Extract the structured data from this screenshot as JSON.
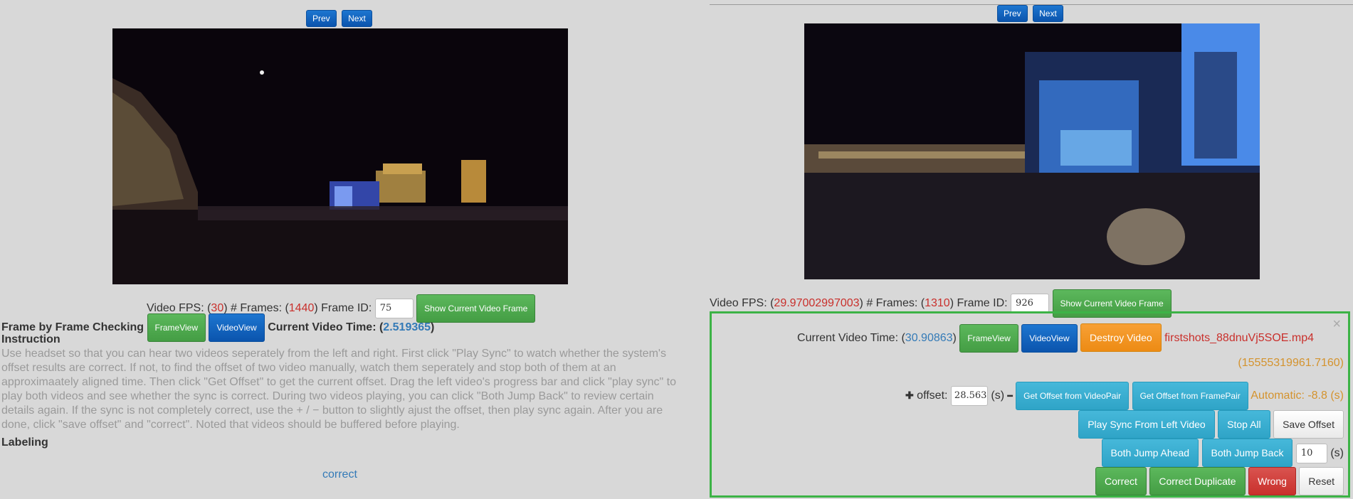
{
  "left": {
    "prev_label": "Prev",
    "next_label": "Next",
    "fps_prefix": "Video FPS: (",
    "fps": "30",
    "frames_prefix": ") # Frames: (",
    "frames": "1440",
    "frame_id_prefix": ") Frame ID:",
    "frame_id": "75",
    "show_frame_label": "Show Current Video Frame",
    "frame_check_title": "Frame by Frame Checking",
    "frameview_label": "FrameView",
    "videoview_label": "VideoView",
    "current_time_prefix": "Current Video Time: (",
    "current_time": "2.519365",
    "current_time_suffix": ")",
    "instruction_title": "Instruction",
    "instruction_text": "Use headset so that you can hear two videos seperately from the left and right. First click \"Play Sync\" to watch whether the system's offset results are correct. If not, to find the offset of two video manually, watch them seperately and stop both of them at an approximaately aligned time. Then click \"Get Offset\" to get the current offset. Drag the left video's progress bar and click \"play sync\" to play both videos and see whether the sync is correct. During two videos playing, you can click \"Both Jump Back\" to review certain details again. If the sync is not completely correct, use the + / − button to slightly ajust the offset, then play sync again. After you are done, click \"save offset\" and \"correct\". Noted that videos should be buffered before playing.",
    "labeling_title": "Labeling",
    "label_value": "correct"
  },
  "right": {
    "prev_label": "Prev",
    "next_label": "Next",
    "fps_prefix": "Video FPS: (",
    "fps": "29.97002997003",
    "frames_prefix": ") # Frames: (",
    "frames": "1310",
    "frame_id_prefix": ") Frame ID:",
    "frame_id": "926",
    "show_frame_label": "Show Current Video Frame",
    "panel": {
      "current_time_prefix": "Current Video Time: (",
      "current_time": "30.90863",
      "current_time_suffix": ")",
      "frameview_label": "FrameView",
      "videoview_label": "VideoView",
      "destroy_label": "Destroy Video",
      "filename": "firstshots_88dnuVj5SOE.mp4",
      "close_symbol": "×",
      "timestamp": "(15555319961.7160)",
      "plus_symbol": "✚",
      "offset_label": "offset:",
      "offset_value": "28.563",
      "seconds_unit": "(s)",
      "minus_symbol": "━",
      "get_offset_video_label": "Get Offset from VideoPair",
      "get_offset_frame_label": "Get Offset from FramePair",
      "automatic_text": "Automatic: -8.8 (s)",
      "play_sync_label": "Play Sync From Left Video",
      "stop_all_label": "Stop All",
      "save_offset_label": "Save Offset",
      "jump_ahead_label": "Both Jump Ahead",
      "jump_back_label": "Both Jump Back",
      "jump_seconds": "10",
      "jump_unit": "(s)",
      "correct_label": "Correct",
      "correct_dup_label": "Correct Duplicate",
      "wrong_label": "Wrong",
      "reset_label": "Reset"
    }
  },
  "colors": {
    "value_red": "#c9302c",
    "value_blue": "#337ab7",
    "panel_border": "#3cb346",
    "automatic_orange": "#d4932e"
  }
}
